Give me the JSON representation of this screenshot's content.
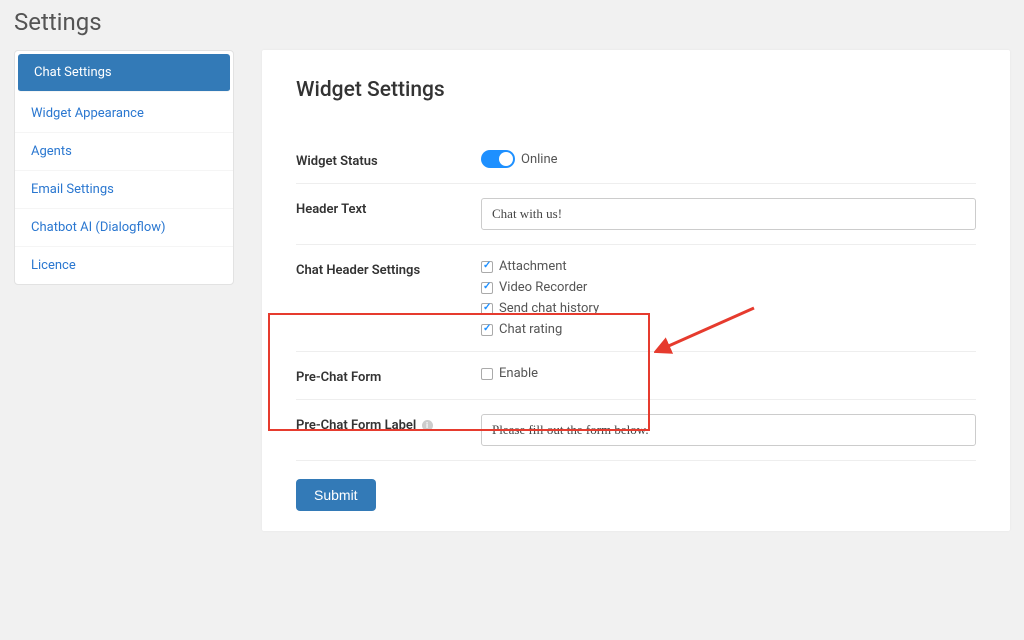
{
  "page": {
    "title": "Settings"
  },
  "sidebar": {
    "items": [
      {
        "label": "Chat Settings",
        "active": true
      },
      {
        "label": "Widget Appearance",
        "active": false
      },
      {
        "label": "Agents",
        "active": false
      },
      {
        "label": "Email Settings",
        "active": false
      },
      {
        "label": "Chatbot AI (Dialogflow)",
        "active": false
      },
      {
        "label": "Licence",
        "active": false
      }
    ]
  },
  "main": {
    "title": "Widget Settings",
    "widget_status": {
      "label": "Widget Status",
      "state_label": "Online",
      "on": true
    },
    "header_text": {
      "label": "Header Text",
      "value": "Chat with us!"
    },
    "chat_header_settings": {
      "label": "Chat Header Settings",
      "options": [
        {
          "label": "Attachment",
          "checked": true
        },
        {
          "label": "Video Recorder",
          "checked": true
        },
        {
          "label": "Send chat history",
          "checked": true
        },
        {
          "label": "Chat rating",
          "checked": true
        }
      ]
    },
    "pre_chat_form": {
      "label": "Pre-Chat Form",
      "option_label": "Enable",
      "checked": false
    },
    "pre_chat_form_label": {
      "label": "Pre-Chat Form Label",
      "value": "Please fill out the form below."
    },
    "submit_label": "Submit"
  },
  "annotation": {
    "highlight_color": "#e63b2e",
    "arrow_color": "#e63b2e"
  }
}
